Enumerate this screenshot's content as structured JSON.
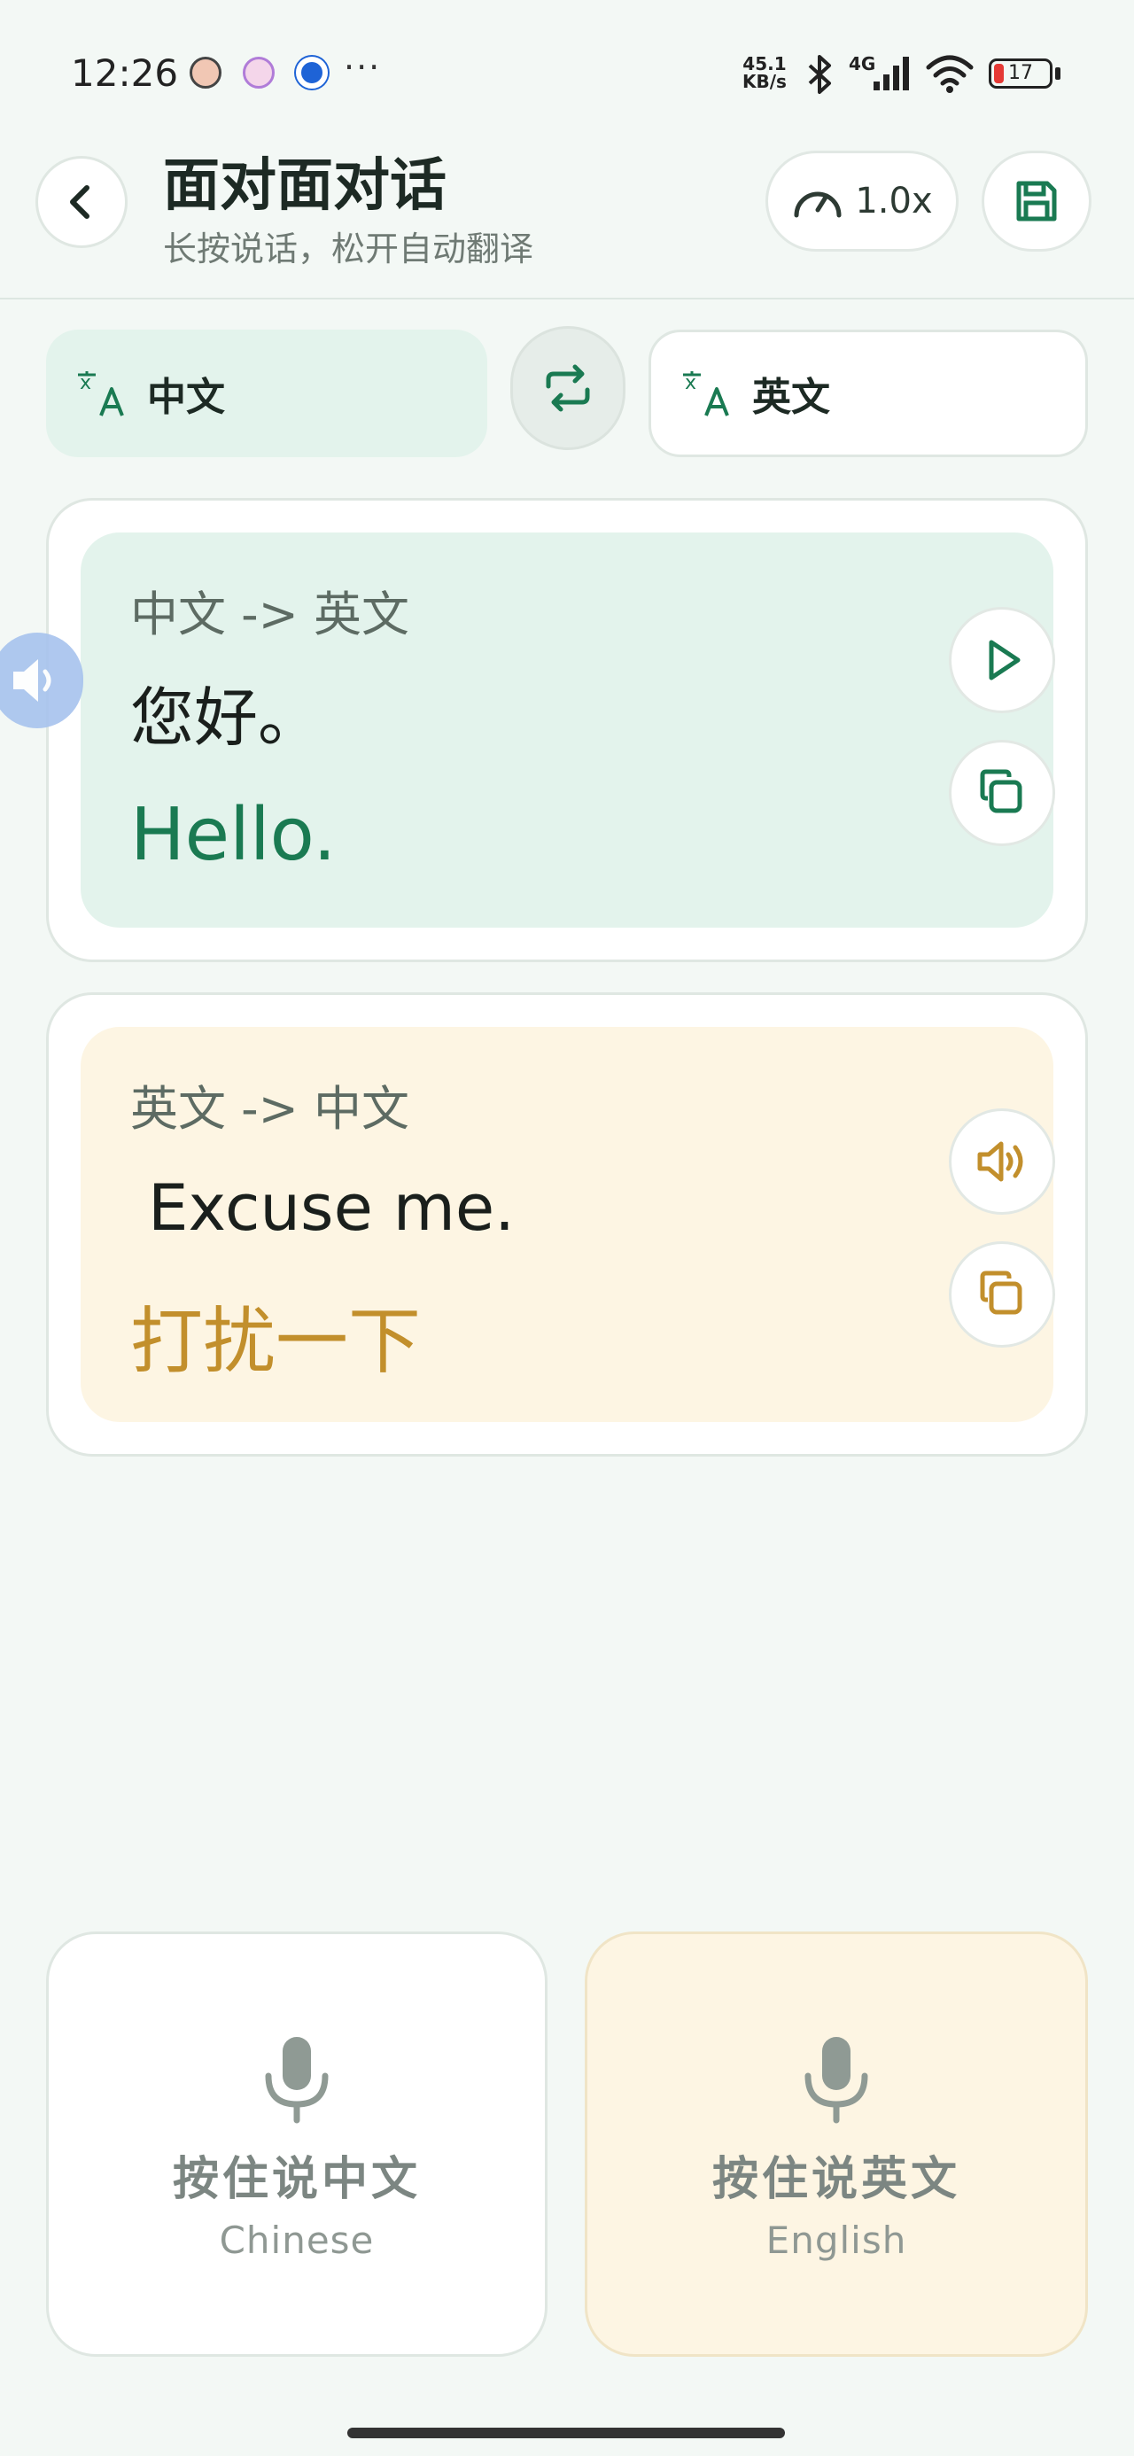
{
  "status_bar": {
    "time": "12:26",
    "dots": "···",
    "net_speed_value": "45.1",
    "net_speed_unit": "KB/s",
    "network": "4G",
    "battery": "17"
  },
  "header": {
    "title": "面对面对话",
    "subtitle": "长按说话，松开自动翻译",
    "speed": "1.0x"
  },
  "languages": {
    "source": "中文",
    "target": "英文"
  },
  "messages": [
    {
      "direction": "中文 -> 英文",
      "original": "您好。",
      "translation": "Hello.",
      "actions": [
        "play-icon",
        "copy-icon"
      ]
    },
    {
      "direction": "英文 -> 中文",
      "original": "Excuse me.",
      "translation": "打扰一下",
      "actions": [
        "speaker-icon",
        "copy-icon"
      ]
    }
  ],
  "mic_buttons": {
    "left": {
      "label": "按住说中文",
      "sub": "Chinese"
    },
    "right": {
      "label": "按住说英文",
      "sub": "English"
    }
  },
  "colors": {
    "accent_green": "#1a7a52",
    "accent_amber": "#c28f2c",
    "card_green_bg": "#e3f3ec",
    "card_amber_bg": "#fdf5e3",
    "side_tab": "#a7c3ee"
  }
}
